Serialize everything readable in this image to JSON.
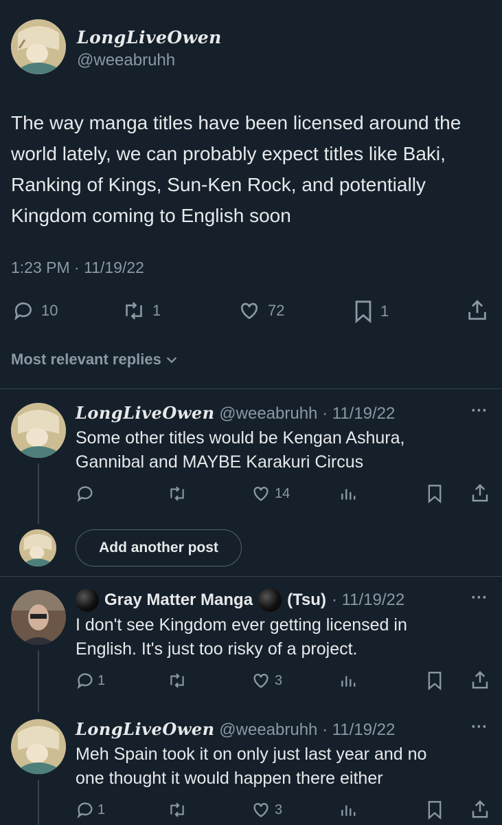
{
  "main_tweet": {
    "display_name": "LongLiveOwen",
    "handle": "@weeabruhh",
    "text": "The way manga titles have been licensed around the world lately, we can probably expect titles like Baki, Ranking of Kings, Sun-Ken Rock, and potentially Kingdom coming to English soon",
    "time": "1:23 PM",
    "separator": "·",
    "date": "11/19/22",
    "replies": "10",
    "retweets": "1",
    "likes": "72",
    "bookmarks": "1"
  },
  "sort": {
    "label": "Most relevant replies"
  },
  "replies": [
    {
      "display_name": "LongLiveOwen",
      "meta": "@weeabruhh · 11/19/22",
      "text_lines": [
        "Some other titles would be Kengan Ashura,",
        "Gannibal and MAYBE Karakuri Circus"
      ],
      "likes": "14"
    },
    {
      "display_name": "Gray Matter Manga",
      "suffix": "(Tsu)",
      "meta": "· 11/19/22",
      "text_lines": [
        "I don't see Kingdom ever getting licensed in",
        "English. It's just too risky of a project."
      ],
      "replies": "1",
      "likes": "3"
    },
    {
      "display_name": "LongLiveOwen",
      "meta": "@weeabruhh · 11/19/22",
      "text_lines": [
        "Meh Spain took it on only just last year and no",
        "one thought it would happen there either"
      ],
      "replies": "1",
      "likes": "3"
    }
  ],
  "add_post": {
    "label": "Add another post"
  },
  "more_label": "···"
}
